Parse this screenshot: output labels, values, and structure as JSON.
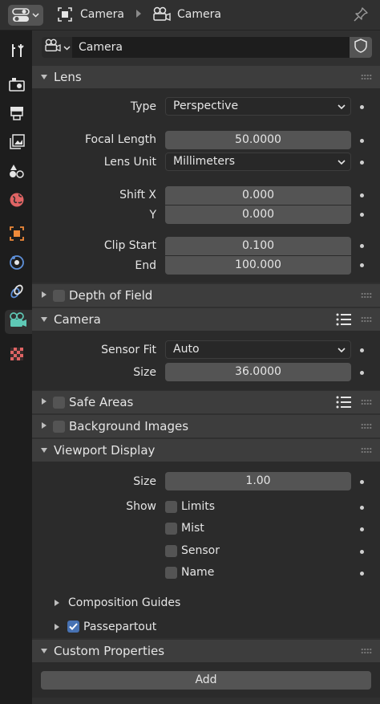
{
  "header": {
    "breadcrumb": [
      {
        "label": "Camera",
        "icon": "object-icon"
      },
      {
        "label": "Camera",
        "icon": "camera-data-icon"
      }
    ]
  },
  "sidebar": {
    "tabs": [
      {
        "name": "tool",
        "icon": "tool-icon"
      },
      {
        "name": "render",
        "icon": "render-icon"
      },
      {
        "name": "output",
        "icon": "output-icon"
      },
      {
        "name": "view-layer",
        "icon": "view-layer-icon"
      },
      {
        "name": "scene",
        "icon": "scene-icon"
      },
      {
        "name": "world",
        "icon": "world-icon"
      },
      {
        "name": "object",
        "icon": "object-icon"
      },
      {
        "name": "physics",
        "icon": "physics-icon"
      },
      {
        "name": "constraints",
        "icon": "constraints-icon"
      },
      {
        "name": "data",
        "icon": "camera-data-icon"
      },
      {
        "name": "texture",
        "icon": "texture-icon"
      }
    ],
    "active": "data"
  },
  "datablock": {
    "name": "Camera"
  },
  "lens": {
    "title": "Lens",
    "type_label": "Type",
    "type_value": "Perspective",
    "focal_label": "Focal Length",
    "focal_value": "50.0000",
    "unit_label": "Lens Unit",
    "unit_value": "Millimeters",
    "shiftx_label": "Shift X",
    "shiftx_value": "0.000",
    "shifty_label": "Y",
    "shifty_value": "0.000",
    "clipstart_label": "Clip Start",
    "clipstart_value": "0.100",
    "clipend_label": "End",
    "clipend_value": "100.000"
  },
  "dof": {
    "title": "Depth of Field",
    "enabled": false
  },
  "camera": {
    "title": "Camera",
    "fit_label": "Sensor Fit",
    "fit_value": "Auto",
    "size_label": "Size",
    "size_value": "36.0000"
  },
  "safe_areas": {
    "title": "Safe Areas",
    "enabled": false
  },
  "background_images": {
    "title": "Background Images",
    "enabled": false
  },
  "viewport": {
    "title": "Viewport Display",
    "size_label": "Size",
    "size_value": "1.00",
    "show_label": "Show",
    "limits": "Limits",
    "mist": "Mist",
    "sensor": "Sensor",
    "name": "Name",
    "composition": "Composition Guides",
    "passepartout": "Passepartout",
    "passepartout_enabled": true
  },
  "custom": {
    "title": "Custom Properties",
    "add_label": "Add"
  },
  "colors": {
    "accent": "#4772b3",
    "active_tab_icon": "#5ec8b5"
  }
}
